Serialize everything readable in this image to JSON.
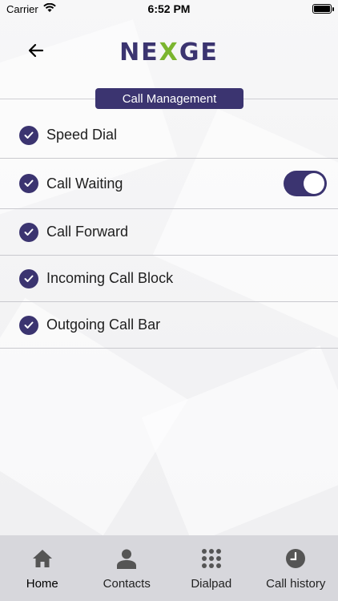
{
  "status_bar": {
    "carrier": "Carrier",
    "time": "6:52 PM"
  },
  "header": {
    "logo_prefix": "NE",
    "logo_x": "X",
    "logo_suffix": "GE"
  },
  "section": {
    "title": "Call Management"
  },
  "items": [
    {
      "label": "Speed Dial",
      "checked": true
    },
    {
      "label": "Call Waiting",
      "checked": true,
      "toggle_on": true
    },
    {
      "label": "Call Forward",
      "checked": true
    },
    {
      "label": "Incoming Call Block",
      "checked": true
    },
    {
      "label": "Outgoing Call Bar",
      "checked": true
    }
  ],
  "tabs": [
    {
      "label": "Home",
      "icon": "home-icon",
      "active": true
    },
    {
      "label": "Contacts",
      "icon": "person-icon"
    },
    {
      "label": "Dialpad",
      "icon": "dialpad-icon"
    },
    {
      "label": "Call history",
      "icon": "clock-icon"
    }
  ],
  "colors": {
    "accent": "#3b3470",
    "logo_x": "#7bb52f",
    "tab_bar": "#d7d7dc"
  }
}
